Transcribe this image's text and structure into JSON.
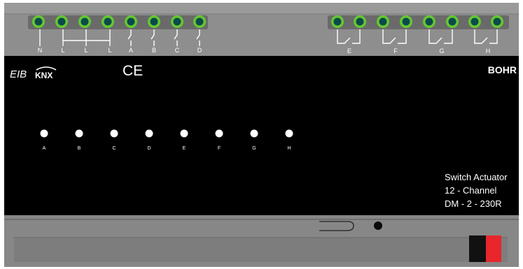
{
  "product": {
    "brand": "BOHR",
    "protocol_text": "EIB",
    "knx_logo_text": "KNX",
    "ce_mark_text": "CE",
    "model_lines": [
      "Switch Actuator",
      "12 - Channel",
      "DM - 2 - 230R"
    ]
  },
  "terminals": {
    "left_labels": [
      "N",
      "L",
      "L",
      "L",
      "A",
      "B",
      "C",
      "D"
    ],
    "right_labels": [
      "E",
      "F",
      "G",
      "H"
    ]
  },
  "indicators": {
    "labels": [
      "A",
      "B",
      "C",
      "D",
      "E",
      "F",
      "G",
      "H"
    ]
  },
  "bus_connector": {
    "colors": [
      "#111111",
      "#e8262b"
    ]
  },
  "colors": {
    "terminal_green": "#64c832",
    "terminal_screw": "#0b4a4a",
    "front_panel": "#000000",
    "body_grey": "#8c8c8c",
    "led_white": "#ffffff"
  }
}
